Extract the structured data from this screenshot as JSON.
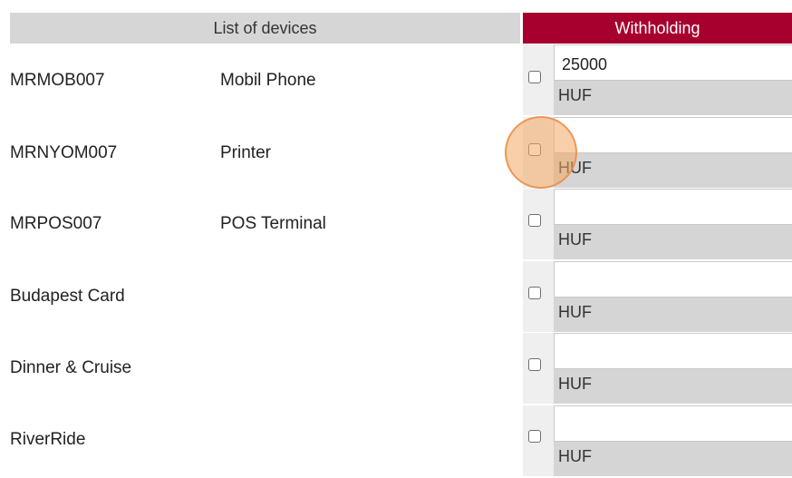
{
  "header": {
    "devices_label": "List of devices",
    "withholding_label": "Withholding"
  },
  "devices": [
    {
      "code": "MRMOB007",
      "name": "Mobil Phone",
      "checked": false,
      "amount": "25000",
      "currency": "HUF"
    },
    {
      "code": "MRNYOM007",
      "name": "Printer",
      "checked": false,
      "amount": "",
      "currency": "HUF"
    },
    {
      "code": "MRPOS007",
      "name": "POS Terminal",
      "checked": false,
      "amount": "",
      "currency": "HUF"
    },
    {
      "code": "Budapest Card",
      "name": "",
      "checked": false,
      "amount": "",
      "currency": "HUF"
    },
    {
      "code": "Dinner & Cruise",
      "name": "",
      "checked": false,
      "amount": "",
      "currency": "HUF"
    },
    {
      "code": "RiverRide",
      "name": "",
      "checked": false,
      "amount": "",
      "currency": "HUF"
    }
  ],
  "colors": {
    "withholding_header": "#a8002e",
    "devices_header": "#d6d6d6",
    "currency_band": "#d5d5d5",
    "click_indicator": "#f4a764"
  }
}
